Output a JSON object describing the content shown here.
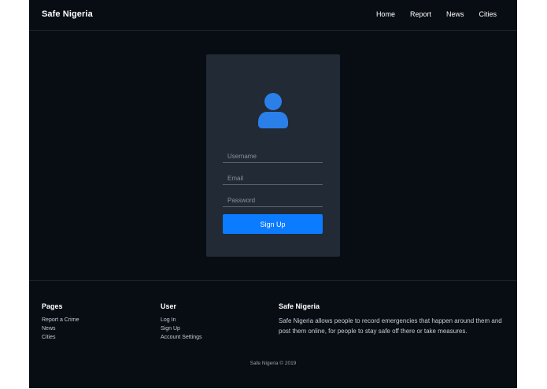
{
  "navbar": {
    "brand": "Safe Nigeria",
    "links": [
      "Home",
      "Report",
      "News",
      "Cities"
    ]
  },
  "form": {
    "icon": "user-icon",
    "username_placeholder": "Username",
    "email_placeholder": "Email",
    "password_placeholder": "Password",
    "submit_label": "Sign Up"
  },
  "footer": {
    "pages": {
      "heading": "Pages",
      "links": [
        "Report a Crime",
        "News",
        "Cities"
      ]
    },
    "user": {
      "heading": "User",
      "links": [
        "Log In",
        "Sign Up",
        "Account Settings"
      ]
    },
    "about": {
      "heading": "Safe Nigeria",
      "text": "Safe Nigeria allows people to record emergencies that happen around them and post them online, for people to stay safe off there or take measures."
    },
    "copyright": "Safe Nigeria © 2019"
  },
  "colors": {
    "background": "#080d14",
    "card": "#212a35",
    "accent": "#0b7bff",
    "icon": "#2a7fe8"
  }
}
